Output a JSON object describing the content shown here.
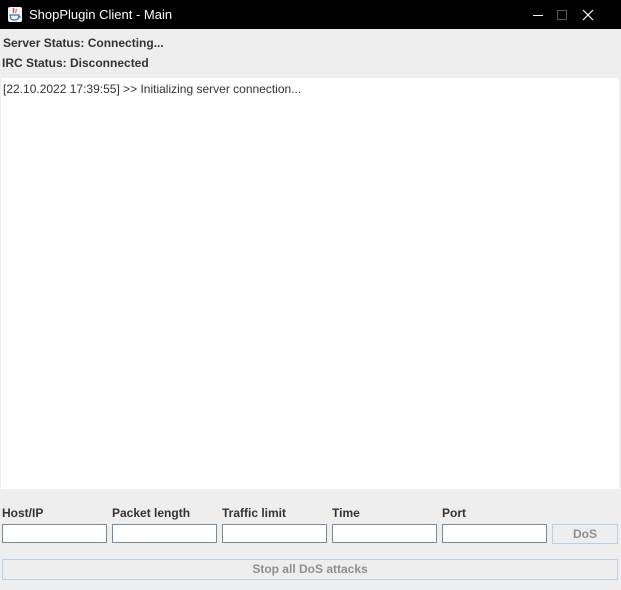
{
  "window": {
    "title": "ShopPlugin Client - Main",
    "icon": "java-cup-icon"
  },
  "status": {
    "server": "Server Status: Connecting...",
    "irc": "IRC Status: Disconnected"
  },
  "log": {
    "lines": [
      "[22.10.2022 17:39:55] >> Initializing server connection..."
    ]
  },
  "form": {
    "fields": [
      {
        "label": "Host/IP",
        "value": ""
      },
      {
        "label": "Packet length",
        "value": ""
      },
      {
        "label": "Traffic limit",
        "value": ""
      },
      {
        "label": "Time",
        "value": ""
      },
      {
        "label": "Port",
        "value": ""
      }
    ],
    "dos_label": "DoS",
    "stop_label": "Stop all DoS attacks"
  },
  "colors": {
    "titlebar": "#000000",
    "panel": "#eeeeee",
    "text": "#333333",
    "disabled_text": "#8e8f8f",
    "button_border": "#b8cfe5"
  }
}
